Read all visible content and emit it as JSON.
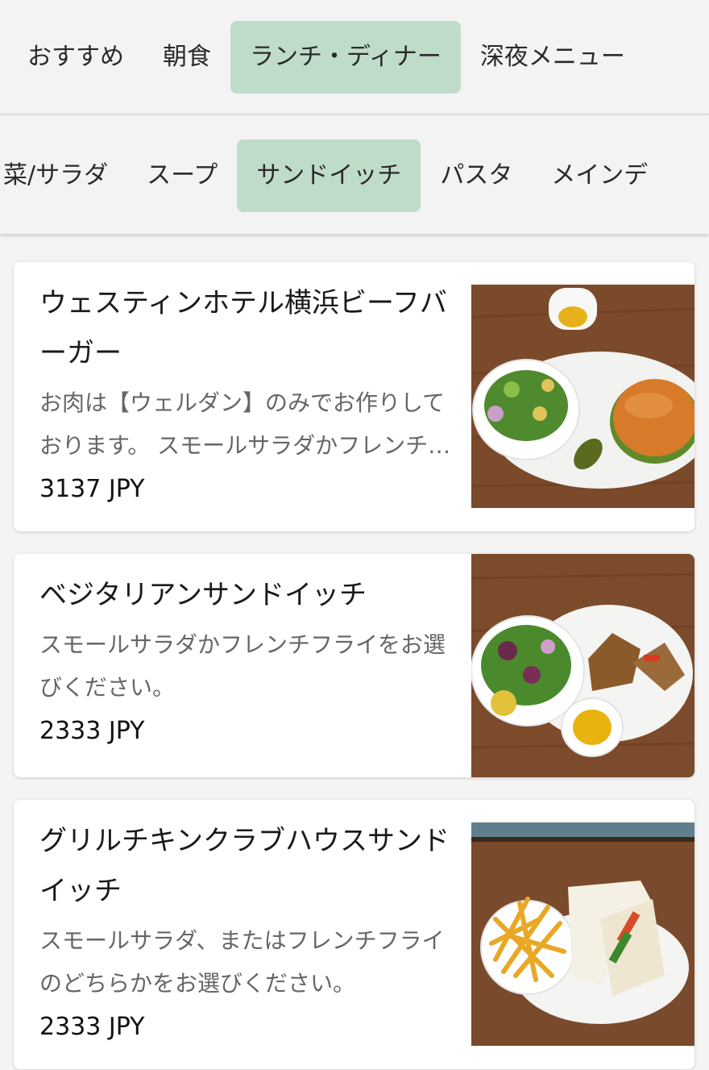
{
  "main_tabs": [
    {
      "label": "おすすめ",
      "active": false
    },
    {
      "label": "朝食",
      "active": false
    },
    {
      "label": "ランチ・ディナー",
      "active": true
    },
    {
      "label": "深夜メニュー",
      "active": false
    }
  ],
  "sub_tabs": [
    {
      "label": "菜/サラダ",
      "active": false
    },
    {
      "label": "スープ",
      "active": false
    },
    {
      "label": "サンドイッチ",
      "active": true
    },
    {
      "label": "パスタ",
      "active": false
    },
    {
      "label": "メインデ",
      "active": false
    }
  ],
  "items": [
    {
      "name": "ウェスティンホテル横浜ビーフバーガー",
      "description": "お肉は【ウェルダン】のみでお作りしております。 スモールサラダかフレンチフライをお選びください。",
      "price": "3137 JPY",
      "image": "burger-plate-image"
    },
    {
      "name": "ベジタリアンサンドイッチ",
      "description": "スモールサラダかフレンチフライをお選びください。",
      "price": "2333 JPY",
      "image": "vegetarian-sandwich-plate-image"
    },
    {
      "name": "グリルチキンクラブハウスサンドイッチ",
      "description": "スモールサラダ、またはフレンチフライのどちらかをお選びください。",
      "price": "2333 JPY",
      "image": "clubhouse-sandwich-fries-image"
    }
  ],
  "colors": {
    "active_tab": "#bfdcc9",
    "background": "#f4f4f4",
    "card": "#ffffff"
  }
}
